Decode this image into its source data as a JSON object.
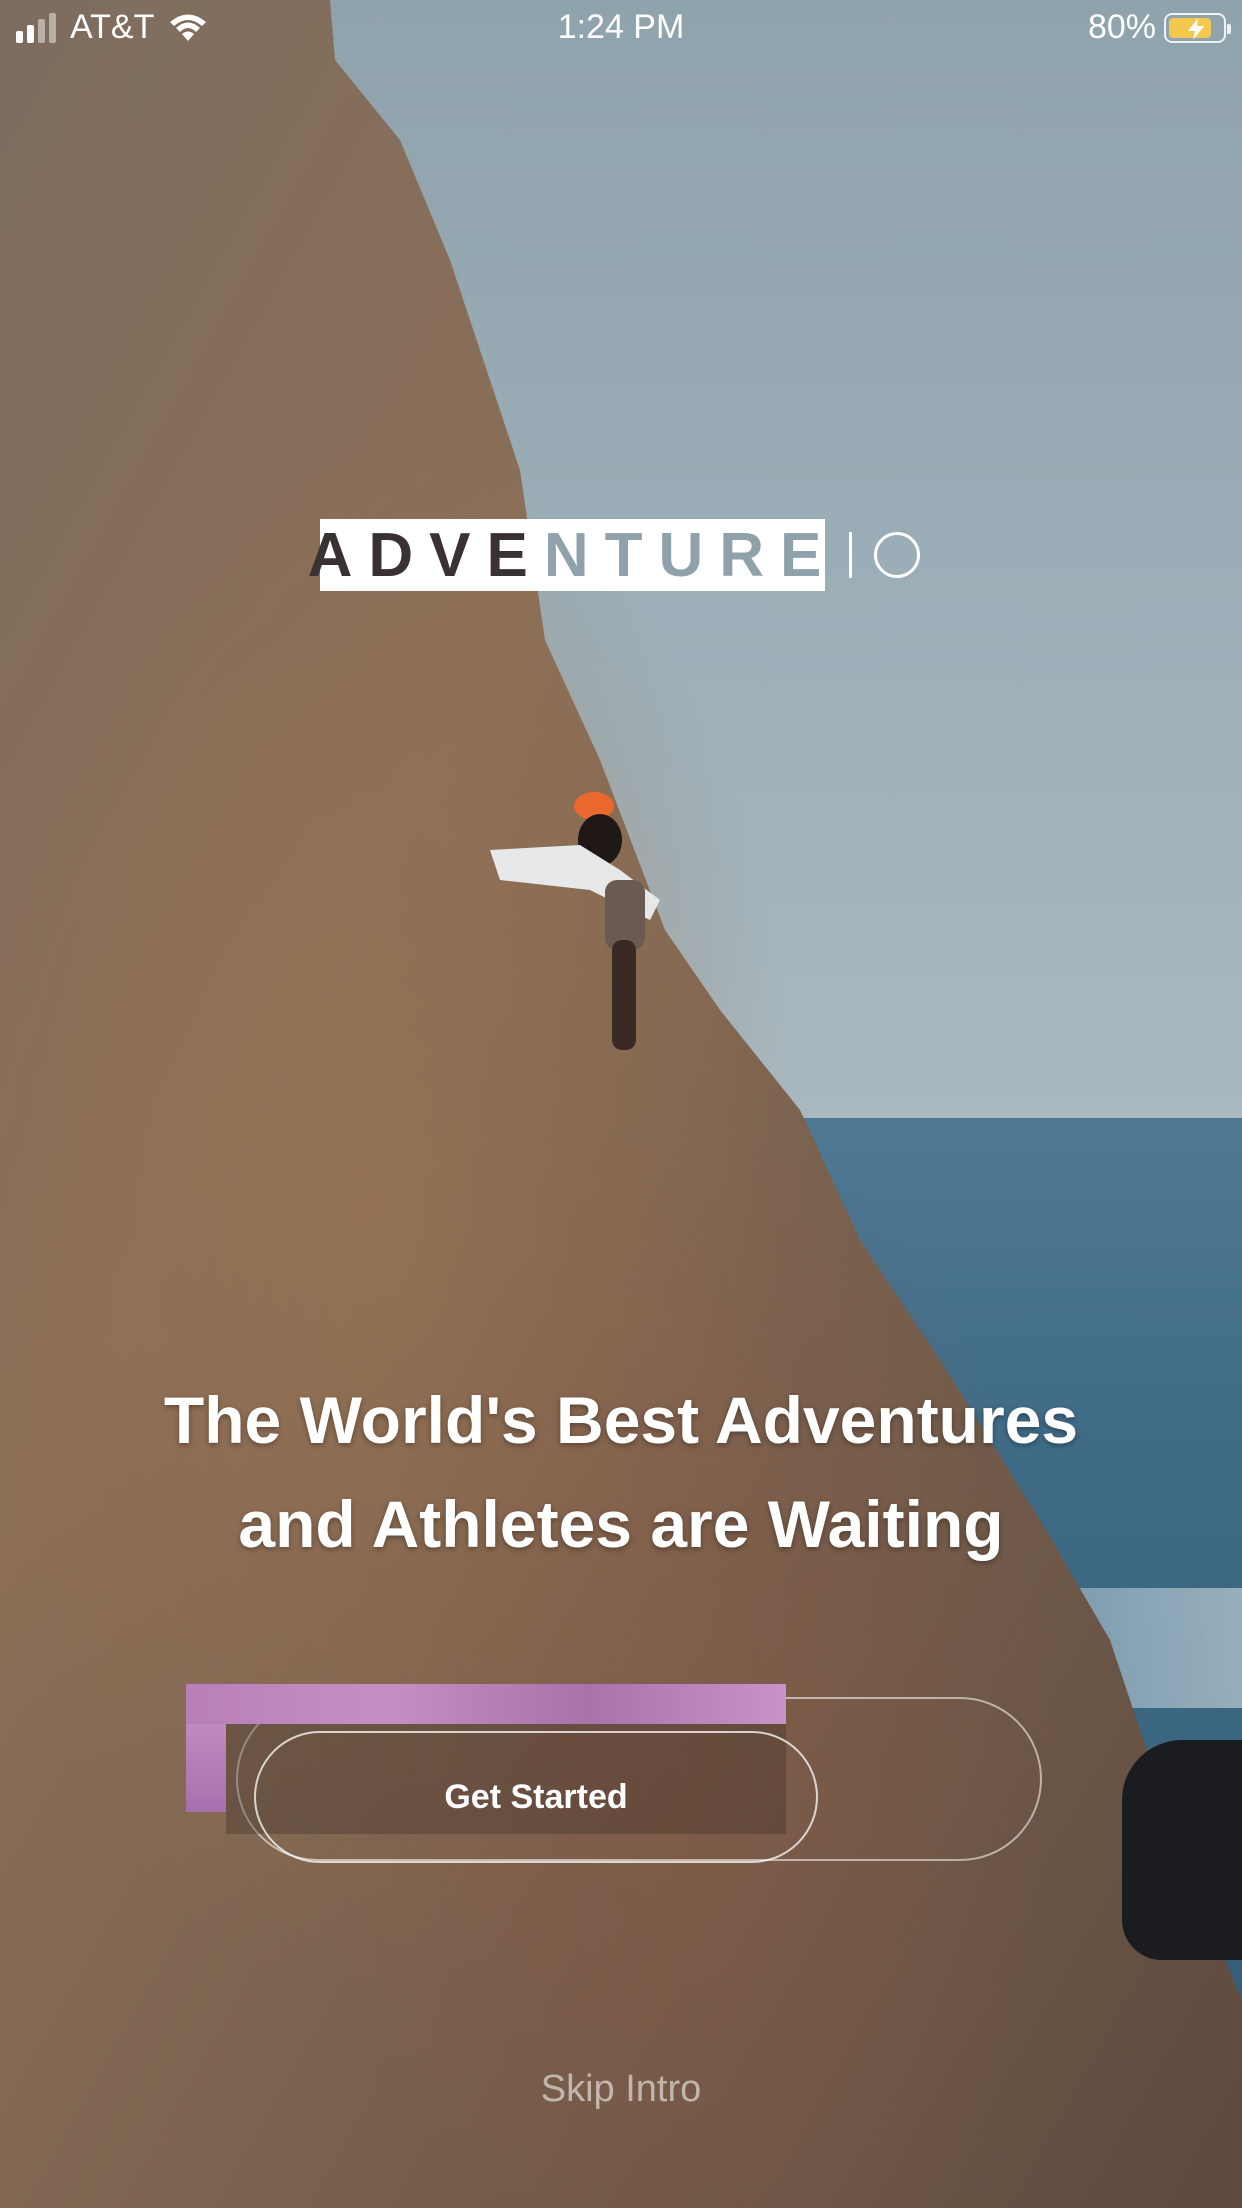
{
  "status_bar": {
    "carrier": "AT&T",
    "time": "1:24 PM",
    "battery_percent": "80%",
    "battery_level": 0.8,
    "battery_color": "#f2c94c"
  },
  "logo": {
    "dark_text": "ADVE",
    "light_text": "NTURE"
  },
  "headline": {
    "line1": "The World's Best Adventures",
    "line2": "and Athletes are Waiting"
  },
  "cta": {
    "label": "Get Started"
  },
  "skip": {
    "label": "Skip Intro"
  },
  "icons": [
    "signal-icon",
    "wifi-icon",
    "battery-icon",
    "charging-bolt-icon",
    "logo-circle-icon"
  ]
}
